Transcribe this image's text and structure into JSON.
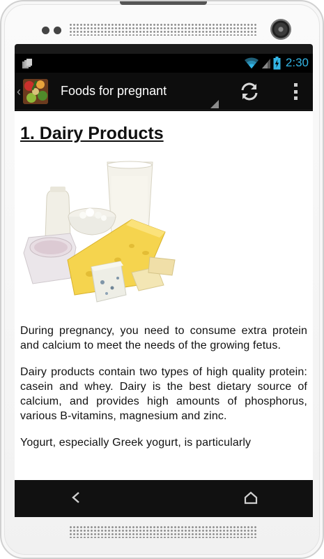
{
  "status_bar": {
    "time": "2:30",
    "accent_color": "#33b5e5",
    "icons": [
      "notification-icon",
      "wifi-icon",
      "signal-icon",
      "battery-charging-icon"
    ]
  },
  "action_bar": {
    "title": "Foods for pregnant",
    "icons": [
      "app-icon",
      "refresh-icon",
      "overflow-menu-icon"
    ]
  },
  "article": {
    "heading": "1. Dairy Products",
    "paragraphs": [
      "During pregnancy, you need to consume extra protein and calcium to meet the needs of the growing fetus.",
      "Dairy products contain two types of high quality protein: casein and whey. Dairy is the best dietary source of calcium, and provides high amounts of phosphorus, various B-vitamins, magnesium and zinc.",
      "Yogurt, especially Greek yogurt, is particularly"
    ]
  },
  "nav_bar": {
    "icons": [
      "back-icon",
      "home-icon"
    ]
  }
}
